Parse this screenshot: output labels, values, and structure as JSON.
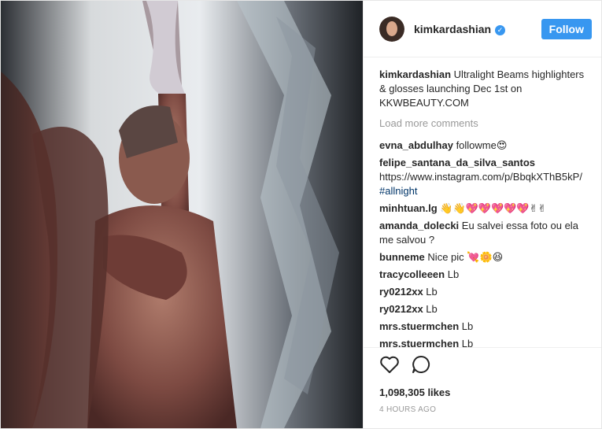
{
  "post": {
    "username": "kimkardashian",
    "verified_icon": "verified-badge-icon",
    "follow_label": "Follow",
    "caption": {
      "user": "kimkardashian",
      "text": "Ultralight Beams highlighters & glosses launching Dec 1st on KKWBEAUTY.COM"
    },
    "load_more_label": "Load more comments",
    "comments": [
      {
        "user": "evna_abdulhay",
        "text": "followme😍"
      },
      {
        "user": "felipe_santana_da_silva_santos",
        "text": "https://www.instagram.com/p/BbqkXThB5kP/",
        "tag": "#allnight"
      },
      {
        "user": "minhtuan.lg",
        "text": "👋👋💖💖💖💖💖✌✌"
      },
      {
        "user": "amanda_dolecki",
        "text": "Eu salvei essa foto ou ela me salvou ?"
      },
      {
        "user": "bunneme",
        "text": "Nice pic 💘🌼😆"
      },
      {
        "user": "tracycolleeen",
        "text": "Lb"
      },
      {
        "user": "ry0212xx",
        "text": "Lb"
      },
      {
        "user": "ry0212xx",
        "text": "Lb"
      },
      {
        "user": "mrs.stuermchen",
        "text": "Lb"
      },
      {
        "user": "mrs.stuermchen",
        "text": "Lb"
      }
    ],
    "likes": "1,098,305 likes",
    "time": "4 HOURS AGO",
    "colors": {
      "accent": "#3897f0",
      "text": "#262626",
      "muted": "#999999"
    }
  }
}
